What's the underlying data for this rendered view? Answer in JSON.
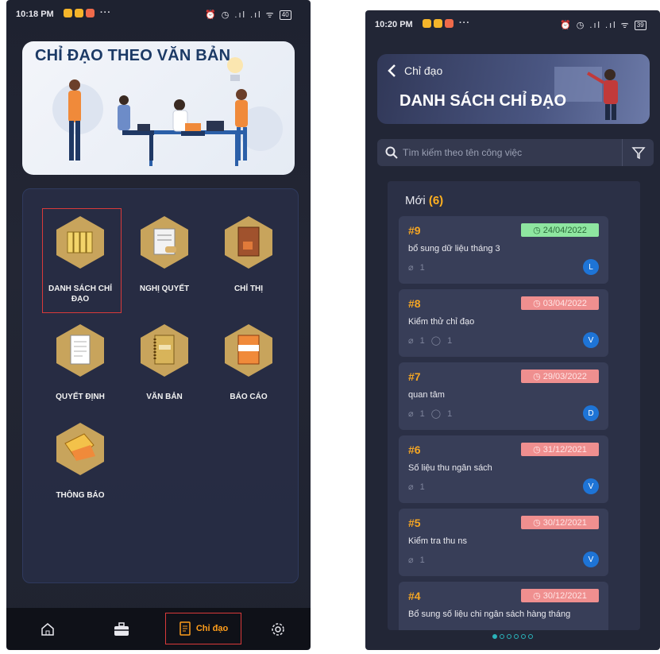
{
  "screen1": {
    "status": {
      "time": "10:18 PM",
      "more": "···",
      "right_icons": "⏰ ◷ .ıl .ıl ᯤ",
      "battery": "40"
    },
    "banner": {
      "title": "CHỈ ĐẠO THEO VĂN BẢN"
    },
    "menu": [
      {
        "label": "DANH SÁCH CHỈ ĐẠO",
        "icon": "folders-icon",
        "selected": true
      },
      {
        "label": "NGHỊ QUYẾT",
        "icon": "signing-icon",
        "selected": false
      },
      {
        "label": "CHỈ THỊ",
        "icon": "book-icon",
        "selected": false
      },
      {
        "label": "QUYẾT ĐỊNH",
        "icon": "document-icon",
        "selected": false
      },
      {
        "label": "VĂN BẢN",
        "icon": "notebook-icon",
        "selected": false
      },
      {
        "label": "BÁO CÁO",
        "icon": "report-icon",
        "selected": false
      },
      {
        "label": "THÔNG BÁO",
        "icon": "megaphone-icon",
        "selected": false
      }
    ],
    "bottom_nav": {
      "active_label": "Chỉ đạo"
    }
  },
  "screen2": {
    "status": {
      "time": "10:20 PM",
      "more": "···",
      "right_icons": "⏰ ◷ .ıl .ıl ᯤ",
      "battery": "39"
    },
    "header": {
      "back_label": "Chỉ đạo",
      "title": "DANH SÁCH CHỈ ĐẠO"
    },
    "search": {
      "placeholder": "Tìm kiếm theo tên công việc"
    },
    "section": {
      "title": "Mới",
      "count": "(6)"
    },
    "tasks": [
      {
        "num": "#9",
        "date": "24/04/2022",
        "status": "green",
        "title": "bổ sung dữ liệu tháng 3",
        "attachments": "1",
        "comments": "",
        "avatar": "L"
      },
      {
        "num": "#8",
        "date": "03/04/2022",
        "status": "red",
        "title": "Kiểm thử chỉ đạo",
        "attachments": "1",
        "comments": "1",
        "avatar": "V"
      },
      {
        "num": "#7",
        "date": "29/03/2022",
        "status": "red",
        "title": "quan tâm",
        "attachments": "1",
        "comments": "1",
        "avatar": "D"
      },
      {
        "num": "#6",
        "date": "31/12/2021",
        "status": "red",
        "title": "Số liệu  thu ngân sách",
        "attachments": "1",
        "comments": "",
        "avatar": "V"
      },
      {
        "num": "#5",
        "date": "30/12/2021",
        "status": "red",
        "title": "Kiểm tra thu ns",
        "attachments": "1",
        "comments": "",
        "avatar": "V"
      },
      {
        "num": "#4",
        "date": "30/12/2021",
        "status": "red",
        "title": "Bổ sung số liệu chi ngân sách hàng tháng",
        "attachments": "",
        "comments": "",
        "avatar": ""
      }
    ],
    "pager": {
      "total": 6,
      "active": 0
    }
  },
  "colors": {
    "accent": "#f5a623",
    "nav_active": "#ff9e1b",
    "date_ok": "#8ee6a0",
    "date_late": "#ef8f8f",
    "selection": "#d93a3a"
  }
}
